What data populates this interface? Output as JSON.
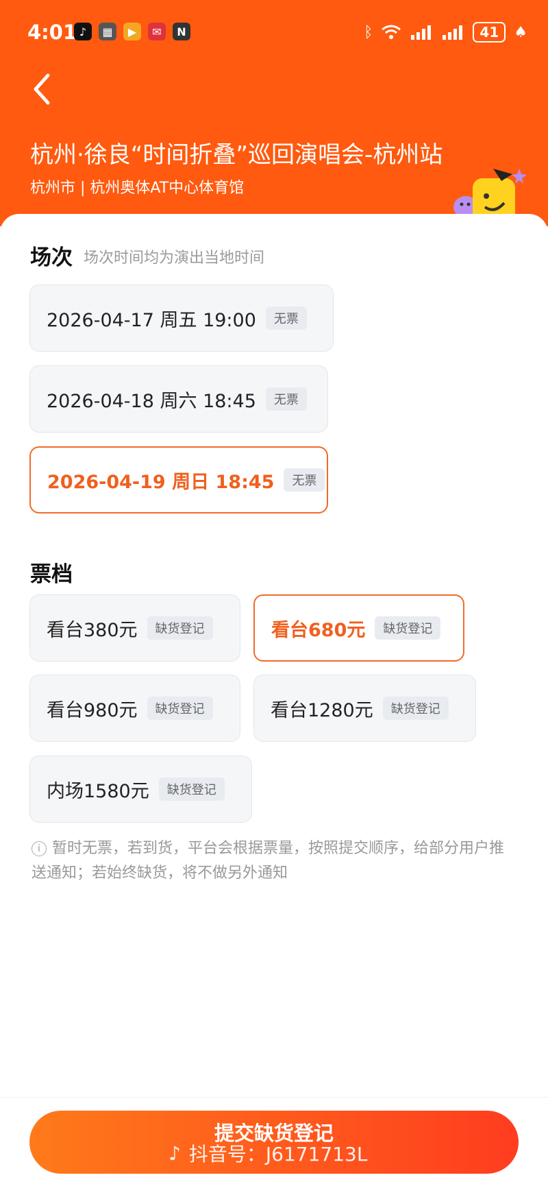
{
  "status_bar": {
    "time": "4:01",
    "battery": "41",
    "apps": [
      {
        "icon": "tiktok-icon",
        "glyph": "♪",
        "color": "#111111"
      },
      {
        "icon": "photo-app-icon",
        "glyph": "▦",
        "color": "#555555"
      },
      {
        "icon": "play-app-icon",
        "glyph": "▶",
        "color": "#f5a623"
      },
      {
        "icon": "mail-app-icon",
        "glyph": "✉",
        "color": "#e0323c"
      },
      {
        "icon": "nfc-icon",
        "glyph": "N",
        "color": "#333333"
      }
    ]
  },
  "header": {
    "title": "杭州·徐良“时间折叠”巡回演唱会-杭州站",
    "subtitle": "杭州市 | 杭州奥体AT中心体育馆"
  },
  "sessions": {
    "title": "场次",
    "hint": "场次时间均为演出当地时间",
    "items": [
      {
        "label": "2026-04-17  周五 19:00",
        "badge": "无票",
        "selected": false
      },
      {
        "label": "2026-04-18 周六 18:45",
        "badge": "无票",
        "selected": false
      },
      {
        "label": "2026-04-19 周日 18:45",
        "badge": "无票",
        "selected": true
      }
    ]
  },
  "tiers": {
    "title": "票档",
    "items": [
      {
        "label": "看台380元",
        "badge": "缺货登记",
        "selected": false
      },
      {
        "label": "看台680元",
        "badge": "缺货登记",
        "selected": true
      },
      {
        "label": "看台980元",
        "badge": "缺货登记",
        "selected": false
      },
      {
        "label": "看台1280元",
        "badge": "缺货登记",
        "selected": false
      },
      {
        "label": "内场1580元",
        "badge": "缺货登记",
        "selected": false
      }
    ]
  },
  "notice": "暂时无票，若到货，平台会根据票量，按照提交顺序，给部分用户推送通知；若始终缺货，将不做另外通知",
  "footer": {
    "button_label": "提交缺货登记",
    "watermark": "抖音号：J6171713L"
  },
  "colors": {
    "brand": "#ff5a0f",
    "accent": "#f0601e"
  }
}
